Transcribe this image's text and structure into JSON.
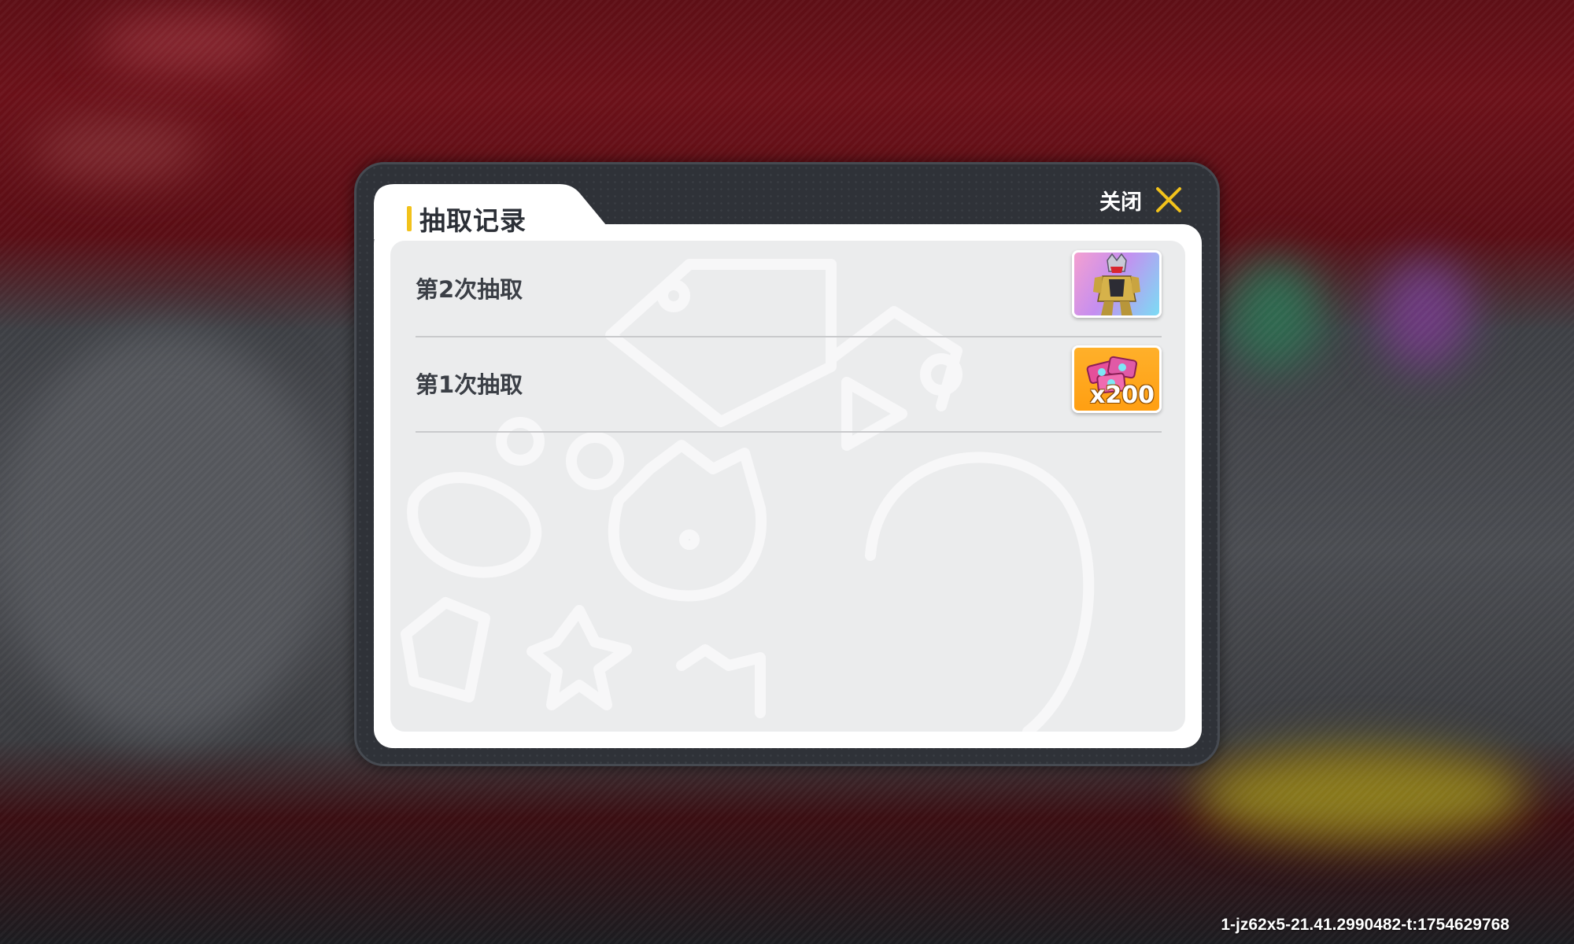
{
  "dialog": {
    "title": "抽取记录",
    "close_label": "关闭"
  },
  "records": [
    {
      "label": "第2次抽取",
      "reward_icon": "character-skin-icon",
      "reward_quantity": ""
    },
    {
      "label": "第1次抽取",
      "reward_icon": "gem-bundle-icon",
      "reward_quantity": "x200"
    }
  ],
  "build_info": "1-jz62x5-21.41.2990482-t:1754629768",
  "colors": {
    "accent_yellow": "#f2c21b",
    "dialog_frame": "#2f3238",
    "panel_bg": "#ebeced",
    "reward_purple": "#c58ef0",
    "reward_orange": "#ff9f12"
  }
}
